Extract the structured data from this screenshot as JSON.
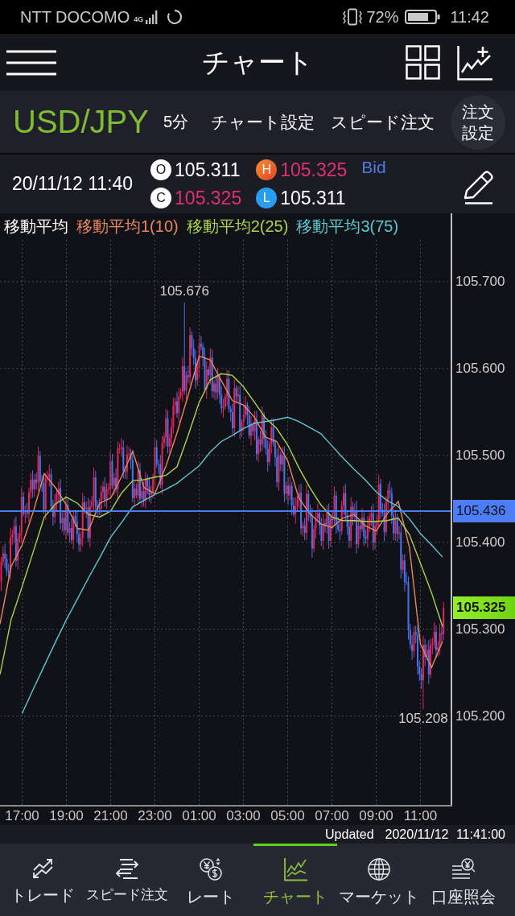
{
  "status_bar": {
    "carrier": "NTT DOCOMO",
    "network": "4G",
    "battery": "72%",
    "time": "11:42"
  },
  "header": {
    "title": "チャート"
  },
  "instrument_bar": {
    "symbol": "USD/JPY",
    "interval": "5分",
    "links": [
      "チャート設定",
      "スピード注文"
    ],
    "order_settings": "注文設定"
  },
  "quote": {
    "datetime": "20/11/12 11:40",
    "values": [
      {
        "kind": "open",
        "letter": "O",
        "value": "105.311",
        "color": "#ffffff"
      },
      {
        "kind": "high",
        "letter": "H",
        "value": "105.325",
        "color": "#e2306e"
      },
      {
        "kind": "close",
        "letter": "C",
        "value": "105.325",
        "color": "#e2306e"
      },
      {
        "kind": "low",
        "letter": "L",
        "value": "105.311",
        "color": "#ffffff"
      }
    ],
    "side": "Bid"
  },
  "chart": {
    "legend_title": "移動平均",
    "chart_data": {
      "type": "line",
      "categories": [
        null,
        null,
        "17:00",
        null,
        null,
        null,
        "19:00",
        null,
        null,
        null,
        "21:00",
        null,
        null,
        null,
        "23:00",
        null,
        null,
        null,
        "01:00",
        null,
        null,
        null,
        "03:00",
        null,
        null,
        null,
        "05:00",
        null,
        null,
        null,
        "07:00",
        null,
        null,
        null,
        "09:00",
        null,
        null,
        null,
        "11:00",
        null,
        null
      ],
      "series": [
        {
          "name": "移動平均1(10)",
          "color": "#e9865e",
          "values": [
            105.306,
            105.372,
            105.397,
            105.435,
            105.479,
            105.463,
            105.443,
            105.416,
            105.414,
            105.445,
            105.451,
            105.476,
            105.505,
            105.463,
            105.456,
            105.488,
            105.526,
            105.569,
            105.614,
            105.61,
            105.586,
            105.563,
            105.558,
            105.544,
            105.521,
            105.516,
            105.494,
            105.451,
            105.433,
            105.421,
            105.417,
            105.428,
            105.432,
            105.419,
            105.413,
            105.433,
            105.447,
            105.394,
            105.283,
            105.256,
            105.286
          ]
        },
        {
          "name": "移動平均2(25)",
          "color": "#a9d34c",
          "values": [
            105.248,
            105.311,
            105.349,
            105.389,
            105.429,
            105.444,
            105.452,
            105.445,
            105.432,
            105.429,
            105.436,
            105.457,
            105.471,
            105.472,
            105.475,
            105.477,
            105.487,
            105.523,
            105.561,
            105.587,
            105.594,
            105.592,
            105.579,
            105.561,
            105.543,
            105.531,
            105.512,
            105.486,
            105.463,
            105.443,
            105.429,
            105.425,
            105.425,
            105.424,
            105.424,
            105.425,
            105.428,
            105.409,
            105.376,
            105.342,
            105.303
          ]
        },
        {
          "name": "移動平均3(75)",
          "color": "#5cc8d0",
          "values": [
            null,
            null,
            105.203,
            105.231,
            105.258,
            105.285,
            105.311,
            105.335,
            105.359,
            105.382,
            105.406,
            105.423,
            105.441,
            105.448,
            105.455,
            105.461,
            105.468,
            105.478,
            105.488,
            105.504,
            105.516,
            105.523,
            105.531,
            105.537,
            105.539,
            105.541,
            105.544,
            105.539,
            105.532,
            105.525,
            105.511,
            105.497,
            105.484,
            105.472,
            105.458,
            105.448,
            105.441,
            105.427,
            105.41,
            105.397,
            105.383
          ]
        }
      ],
      "ylim": [
        105.096,
        105.748
      ],
      "yticks": [
        {
          "value": 105.7,
          "label": "105.700"
        },
        {
          "value": 105.6,
          "label": "105.600"
        },
        {
          "value": 105.5,
          "label": "105.500"
        },
        {
          "value": 105.4,
          "label": "105.400"
        },
        {
          "value": 105.3,
          "label": "105.300"
        },
        {
          "value": 105.2,
          "label": "105.200"
        }
      ],
      "grid": true,
      "ref_lines": [
        {
          "axis": "y",
          "value": 105.436,
          "label": "105.436"
        }
      ]
    },
    "high_label": "105.676",
    "low_label": "105.208",
    "price_tag": "105.325"
  },
  "updated": {
    "label": "Updated",
    "timestamp": "2020/11/12 11:41:00"
  },
  "bottom_nav": [
    {
      "kind": "trade",
      "label": "トレード",
      "selected": false
    },
    {
      "kind": "speed",
      "label": "スピード注文",
      "selected": false
    },
    {
      "kind": "rate",
      "label": "レート",
      "selected": false
    },
    {
      "kind": "chart",
      "label": "チャート",
      "selected": true
    },
    {
      "kind": "market",
      "label": "マーケット",
      "selected": false
    },
    {
      "kind": "account",
      "label": "口座照会",
      "selected": false
    }
  ]
}
